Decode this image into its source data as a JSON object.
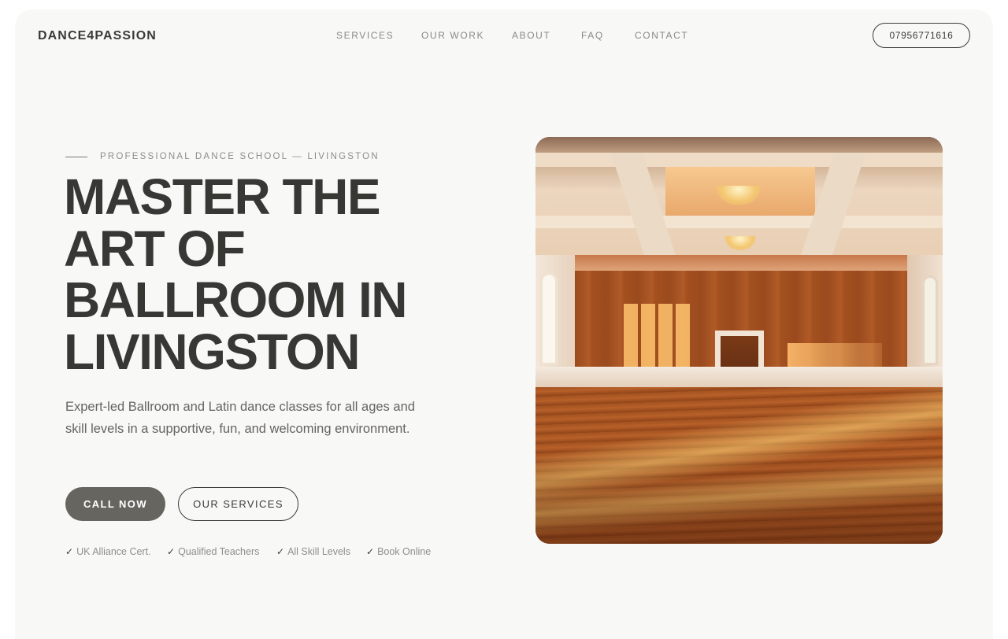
{
  "brand": {
    "logo_text": "DANCE4PASSION"
  },
  "nav": {
    "items": [
      {
        "label": "SERVICES"
      },
      {
        "label": "OUR WORK"
      },
      {
        "label": "ABOUT"
      },
      {
        "label": "FAQ"
      },
      {
        "label": "CONTACT"
      }
    ],
    "phone_label": "07956771616"
  },
  "hero": {
    "eyebrow": "PROFESSIONAL DANCE SCHOOL — LIVINGSTON",
    "headline_lines": [
      "MASTER THE",
      "ART OF",
      "BALLROOM IN",
      "LIVINGSTON"
    ],
    "subtext": "Expert-led Ballroom and Latin dance classes for all ages and skill levels in a supportive, fun, and welcoming environment.",
    "primary_cta": "CALL NOW",
    "secondary_cta": "OUR SERVICES",
    "badges": [
      {
        "check": "✓",
        "label": "UK Alliance Cert."
      },
      {
        "check": "✓",
        "label": "Qualified Teachers"
      },
      {
        "check": "✓",
        "label": "All Skill Levels"
      },
      {
        "check": "✓",
        "label": "Book Online"
      }
    ],
    "image_subject": "sunlit ballroom with wooden floor and chandeliers"
  },
  "colors": {
    "background": "#f8f8f6",
    "text_dark": "#373733",
    "text_muted": "#8a8984",
    "primary_button": "#67655f"
  }
}
